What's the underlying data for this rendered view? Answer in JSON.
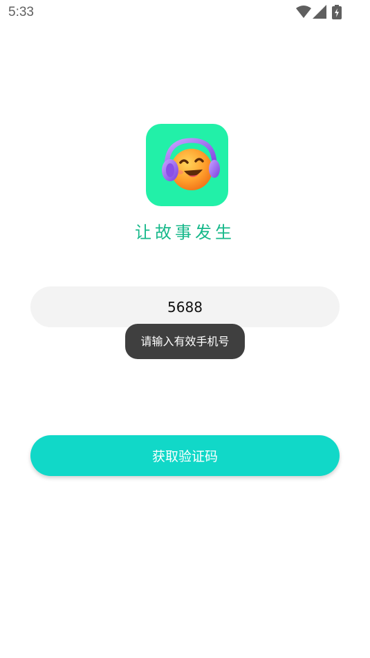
{
  "status_bar": {
    "time": "5:33",
    "icons": [
      "wifi-icon",
      "signal-icon",
      "battery-charging-icon"
    ]
  },
  "logo": {
    "icon": "emoji-headphones-icon",
    "background_color": "#22f0a8"
  },
  "slogan": "让故事发生",
  "phone_input": {
    "value": "5688"
  },
  "toast": {
    "message": "请输入有效手机号"
  },
  "get_code_button": {
    "label": "获取验证码",
    "color": "#11d8c8"
  }
}
